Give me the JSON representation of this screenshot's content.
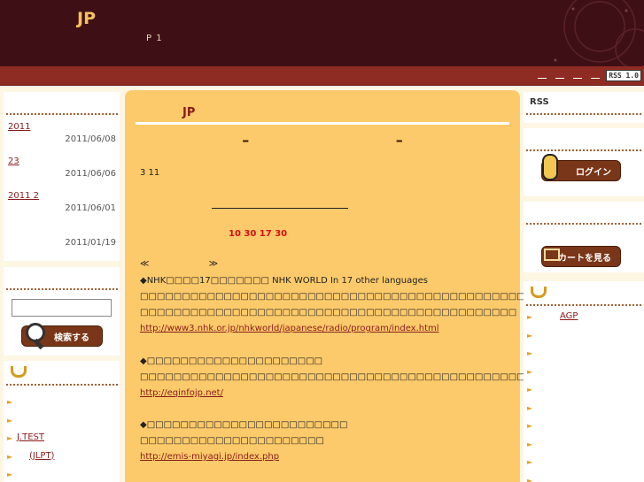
{
  "header": {
    "site_title": "JP",
    "subtitle": "P 1",
    "nav_links": [
      "",
      "",
      "",
      ""
    ],
    "rss_badge": "RSS 1.0"
  },
  "left": {
    "recent_entries": [
      {
        "title": "2011",
        "date": "2011/06/08"
      },
      {
        "title": "23",
        "date": "2011/06/06"
      },
      {
        "title": "2011  2",
        "date": "2011/06/01"
      },
      {
        "title": "",
        "date": "2011/01/19"
      }
    ],
    "search": {
      "input_value": "",
      "button_label": "検索する"
    },
    "categories": [
      "",
      "",
      "J.TEST",
      "(JLPT)",
      ""
    ]
  },
  "main": {
    "entry_category": "JP",
    "entry_title": "– –",
    "line_311": "3 11",
    "red_text": "10  30    17  30",
    "prev_label": "≪",
    "next_label": "≫",
    "blocks": [
      {
        "heading": "◆NHK□□□□17□□□□□□□ NHK WORLD In 17 other languages",
        "body": [
          "□□□□□□□□□□□□□□□□□□□□□□□□□□□□□□□□□□□□□□□□□□□□□□□□□□□□□□□□□□",
          "□□□□□□□□□□□□□□□□□□□□□□□□□□□□□□□□□□□□□□□□□□□□□"
        ],
        "link": "http://www3.nhk.or.jp/nhkworld/japanese/radio/program/index.html"
      },
      {
        "heading": "◆□□□□□□□□□□□□□□□□□□□□□",
        "body": [
          "□□□□□□□□□□□□□□□□□□□□□□□□□□□□□□□□□□□□□□□□□□□□□□□□□□□□□□□□□□"
        ],
        "link": "http://eqinfojp.net/"
      },
      {
        "heading": "◆□□□□□□□□□□□□□□□□□□□□□□□□",
        "body": [
          "□□□□□□□□□□□□□□□□□□□□□□"
        ],
        "link": "http://emis-miyagi.jp/index.php"
      }
    ]
  },
  "right": {
    "rss_title": "RSS",
    "login_label": "ログイン",
    "cart_label": "カートを見る",
    "categories": [
      "AGP",
      "",
      "",
      "",
      "",
      "",
      "",
      "",
      "",
      ""
    ]
  }
}
